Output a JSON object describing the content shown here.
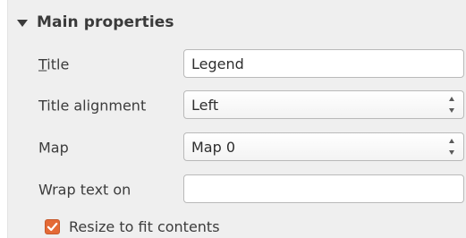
{
  "group": {
    "title": "Main properties"
  },
  "fields": {
    "title": {
      "label": "Title",
      "value": "Legend"
    },
    "title_alignment": {
      "label": "Title alignment",
      "value": "Left"
    },
    "map": {
      "label": "Map",
      "value": "Map 0"
    },
    "wrap_text": {
      "label": "Wrap text on",
      "value": ""
    }
  },
  "resize": {
    "label": "Resize to fit contents",
    "checked": true
  },
  "colors": {
    "panel_bg": "#efefef",
    "checkbox_accent": "#e46a36"
  },
  "icons": {
    "group_toggle": "triangle-down-icon",
    "combo_spinner": "up-down-arrows-icon",
    "checkmark": "checkmark-icon"
  }
}
